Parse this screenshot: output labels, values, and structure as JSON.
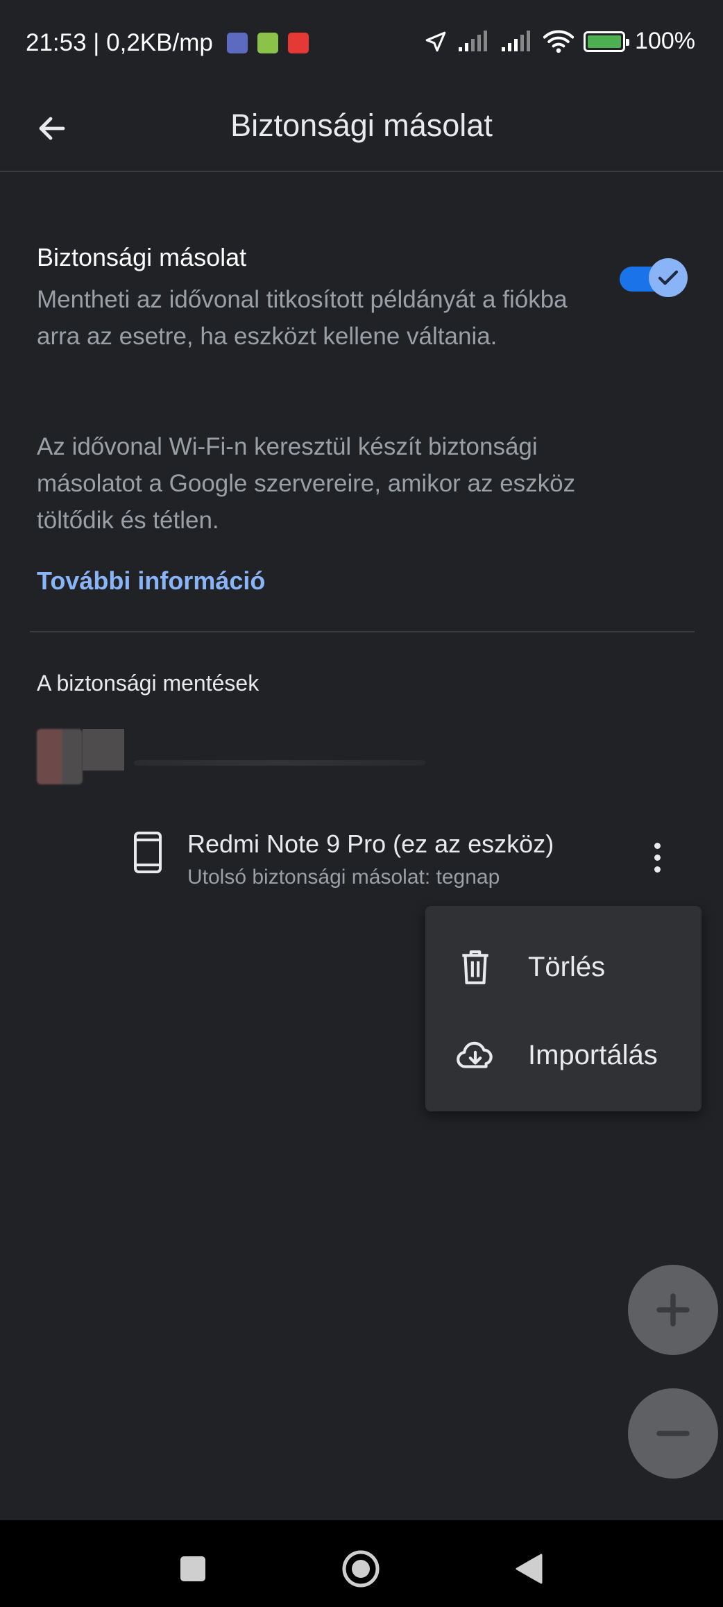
{
  "status_bar": {
    "time_speed": "21:53 | 0,2KB/mp",
    "battery": "100%"
  },
  "app_bar": {
    "title": "Biztonsági másolat"
  },
  "backup_setting": {
    "title": "Biztonsági másolat",
    "description": "Mentheti az idővonal titkosított példányát a fiókba arra az esetre, ha eszközt kellene váltania.",
    "description2": "Az idővonal Wi-Fi-n keresztül készít biztonsági másolatot a Google szervereire, amikor az eszköz töltődik és tétlen.",
    "more_info": "További információ",
    "enabled": true
  },
  "backups_section": {
    "title": "A biztonsági mentések",
    "device": {
      "name": "Redmi Note 9 Pro (ez az eszköz)",
      "last_backup": "Utolsó biztonsági másolat: tegnap"
    }
  },
  "menu": {
    "items": [
      {
        "label": "Törlés",
        "icon": "trash-icon"
      },
      {
        "label": "Importálás",
        "icon": "cloud-download-icon"
      }
    ]
  },
  "colors": {
    "background": "#212226",
    "accent": "#8ab4f8",
    "toggle_track": "#1a73e8",
    "menu_bg": "#303134"
  }
}
